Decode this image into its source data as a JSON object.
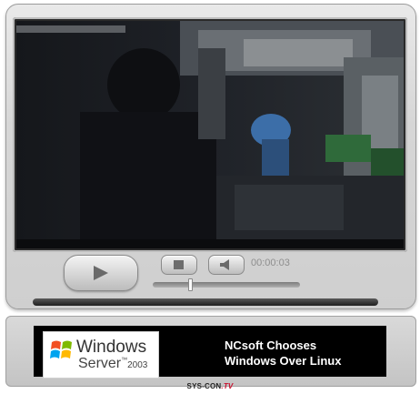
{
  "brand": {
    "name": "SYS-CON",
    "suffix": ".TV"
  },
  "player": {
    "timecode": "00:00:03",
    "seek_progress": 0.24,
    "play_icon": "play-icon",
    "stop_icon": "stop-icon",
    "volume_icon": "speaker-icon"
  },
  "banner": {
    "logo": {
      "line1": "Windows",
      "line2": "Server",
      "year": "2003",
      "tm": "™",
      "icon": "windows-flag-icon"
    },
    "headline_line1": "NCsoft Chooses",
    "headline_line2": "Windows Over Linux"
  },
  "colors": {
    "brand_accent": "#c8102e",
    "banner_bg": "#000000"
  }
}
